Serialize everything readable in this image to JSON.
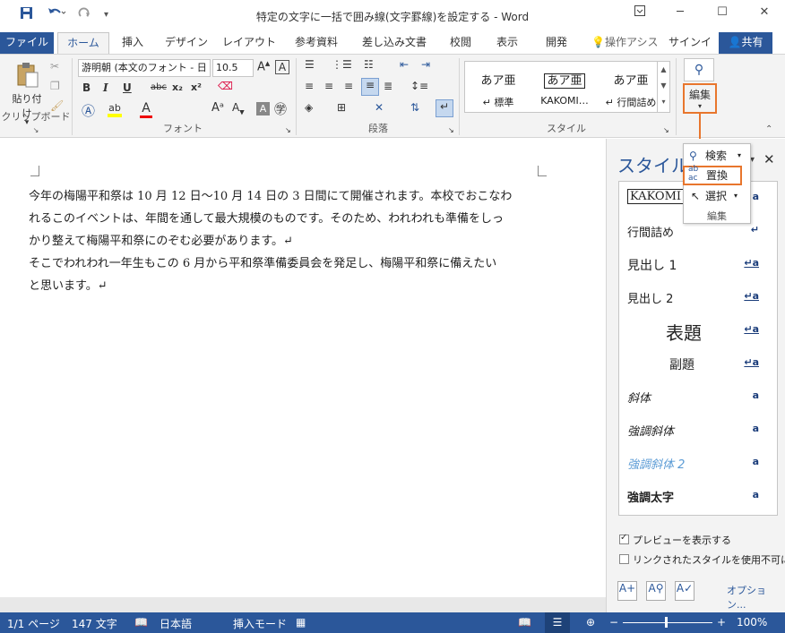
{
  "window": {
    "title": "特定の文字に一括で囲み線(文字罫線)を設定する - Word",
    "help_icon": "ribbon-display-icon",
    "minimize": "─",
    "maximize": "☐",
    "close": "✕"
  },
  "quick_access": {
    "save_icon": "save-icon",
    "undo_icon": "undo-icon",
    "redo_icon": "redo-icon",
    "customize_icon": "customize-icon"
  },
  "tabs": [
    "ファイル",
    "ホーム",
    "挿入",
    "デザイン",
    "レイアウト",
    "参考資料",
    "差し込み文書",
    "校閲",
    "表示",
    "開発"
  ],
  "tell_me": "操作アシスト",
  "signin": "サインイン",
  "share": "共有",
  "ribbon": {
    "clipboard": {
      "paste": "貼り付け",
      "label": "クリップボード"
    },
    "font": {
      "name": "游明朝 (本文のフォント - 日",
      "size": "10.5",
      "bold": "B",
      "italic": "I",
      "underline": "U",
      "strike": "abc",
      "subscript": "x₂",
      "superscript": "x²",
      "label": "フォント"
    },
    "paragraph": {
      "label": "段落"
    },
    "styles": {
      "items": [
        {
          "preview": "あア亜",
          "name": "↵ 標準"
        },
        {
          "preview": "あア亜",
          "name": "KAKOMI…"
        },
        {
          "preview": "あア亜",
          "name": "↵ 行間詰め"
        }
      ],
      "label": "スタイル"
    },
    "editing": {
      "label": "編集"
    }
  },
  "document": {
    "paragraphs": [
      "今年の梅陽平和祭は 10 月 12 日〜10 月 14 日の 3 日間にて開催されます。本校でおこなわ",
      "れるこのイベントは、年間を通して最大規模のものです。そのため、われわれも準備をしっ",
      "かり整えて梅陽平和祭にのぞむ必要があります。↵",
      "そこでわれわれ一年生もこの 6 月から平和祭準備委員会を発足し、梅陽平和祭に備えたい",
      "と思います。↵"
    ]
  },
  "styles_pane": {
    "title": "スタイル",
    "items": [
      {
        "name": "KAKOMI",
        "mark": "a"
      },
      {
        "name": "行間詰め",
        "mark": "↵"
      },
      {
        "name": "見出し 1",
        "mark": "↵a"
      },
      {
        "name": "見出し 2",
        "mark": "↵a"
      },
      {
        "name": "表題",
        "mark": "↵a"
      },
      {
        "name": "副題",
        "mark": "↵a"
      },
      {
        "name": "斜体",
        "mark": "a"
      },
      {
        "name": "強調斜体",
        "mark": "a"
      },
      {
        "name": "強調斜体 2",
        "mark": "a"
      },
      {
        "name": "強調太字",
        "mark": "a"
      }
    ],
    "show_preview": "プレビューを表示する",
    "disable_linked": "リンクされたスタイルを使用不可にする",
    "options": "オプション..."
  },
  "edit_dropdown": {
    "find": "検索",
    "replace": "置換",
    "select": "選択",
    "label": "編集"
  },
  "statusbar": {
    "page": "1/1 ページ",
    "words": "147 文字",
    "language": "日本語",
    "mode": "挿入モード",
    "zoom": "100%"
  },
  "colors": {
    "accent": "#2b579a",
    "highlight": "#e8762d"
  }
}
